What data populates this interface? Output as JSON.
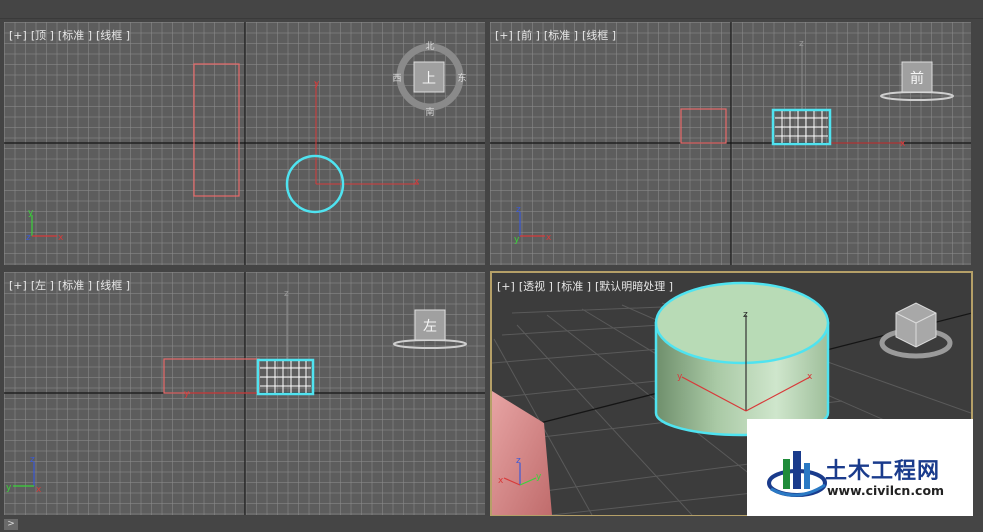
{
  "viewports": {
    "top": {
      "labels": [
        "[+]",
        "[顶 ]",
        "[标准 ]",
        "[线框 ]"
      ],
      "cube_face": "上",
      "compass": {
        "n": "北",
        "s": "南",
        "e": "东",
        "w": "西"
      }
    },
    "front": {
      "labels": [
        "[+]",
        "[前 ]",
        "[标准 ]",
        "[线框 ]"
      ],
      "cube_face": "前"
    },
    "left": {
      "labels": [
        "[+]",
        "[左 ]",
        "[标准 ]",
        "[线框 ]"
      ],
      "cube_face": "左"
    },
    "persp": {
      "labels": [
        "[+]",
        "[透视 ]",
        "[标准 ]",
        "[默认明暗处理 ]"
      ]
    }
  },
  "axes": {
    "x": "x",
    "y": "y",
    "z": "z"
  },
  "watermark": {
    "title": "土木工程网",
    "url": "www.civilcn.com"
  },
  "bottom": {
    "expand": ">"
  },
  "colors": {
    "selection": "#4fe3f0",
    "object": "#e86a6a",
    "grid": "#8c8c8c",
    "active_border": "#b5a068",
    "cylinder": "#b8dbb6"
  }
}
